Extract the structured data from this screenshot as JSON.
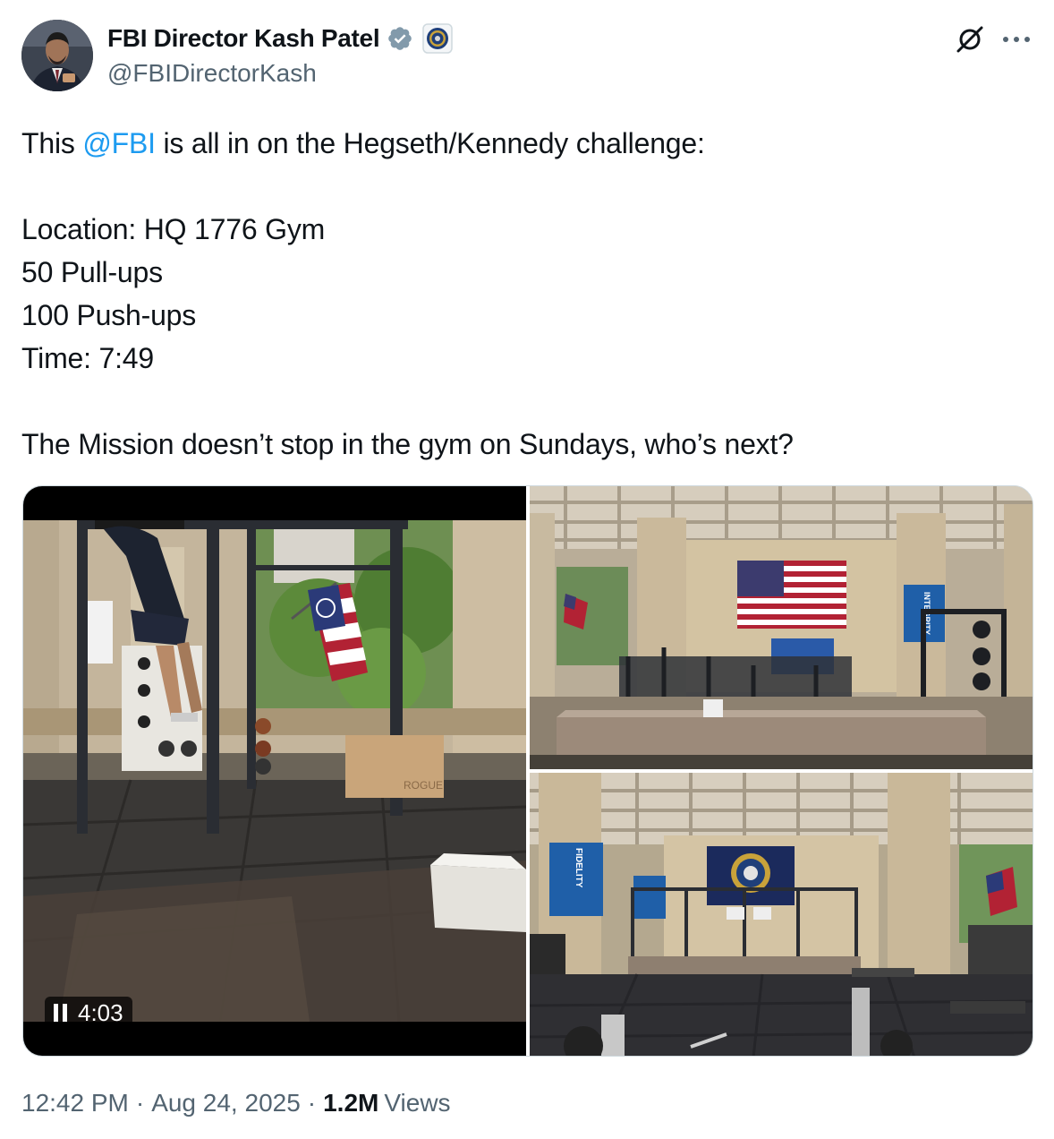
{
  "author": {
    "display_name": "FBI Director Kash Patel",
    "handle": "@FBIDirectorKash",
    "verified_badge_color": "#829aab",
    "affiliate_badge": "fbi-seal-icon"
  },
  "tweet": {
    "line1_prefix": "This ",
    "line1_mention": "@FBI",
    "line1_suffix": " is all in on the Hegseth/Kennedy challenge:",
    "location": "Location: HQ 1776 Gym",
    "pullups": "50 Pull-ups",
    "pushups": "100 Push-ups",
    "time": "Time: 7:49",
    "closing": "The Mission doesn’t stop in the gym on Sundays, who’s next?"
  },
  "media": {
    "video_time": "4:03",
    "video_state": "playing",
    "photo_top_banner": "INTEGRITY",
    "photo_bottom_banner": "FIDELITY",
    "video_box_label": "ROGUE"
  },
  "meta": {
    "time": "12:42 PM",
    "date": "Aug 24, 2025",
    "views_count": "1.2M",
    "views_label": "Views"
  },
  "colors": {
    "link": "#1d9bf0",
    "secondary_text": "#536471",
    "primary_text": "#0f1419"
  }
}
